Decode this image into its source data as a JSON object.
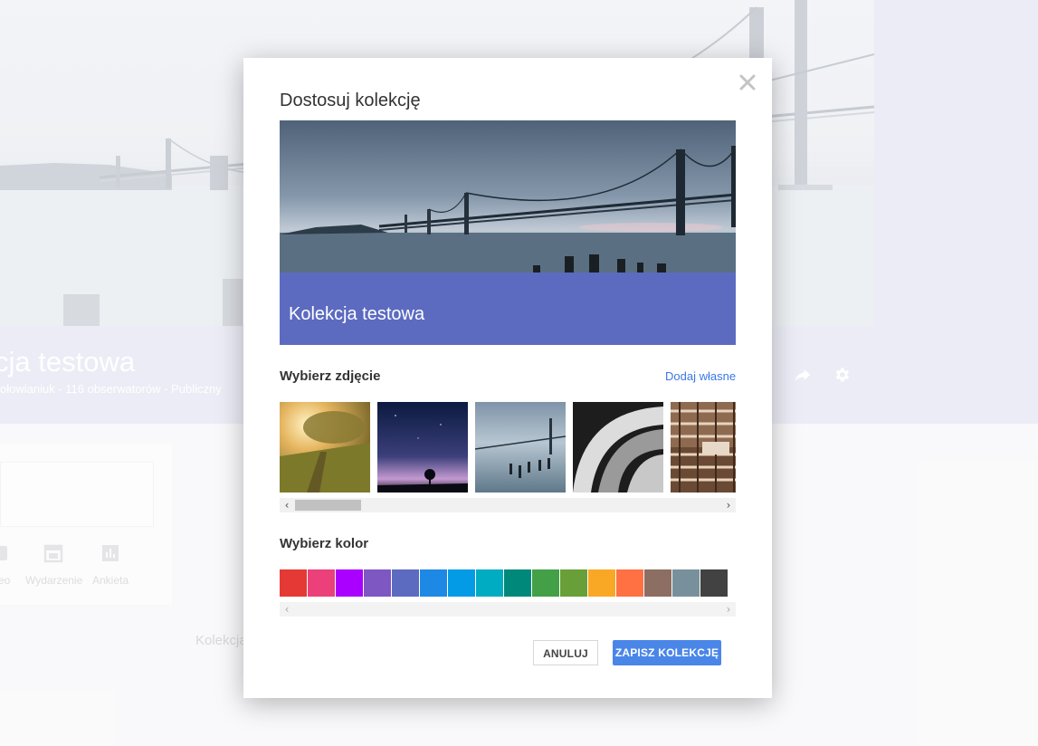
{
  "background": {
    "title": "cja testowa",
    "subtitle": "ołowianiuk - 116 obserwatorów - Publiczny",
    "post_options": [
      "eo",
      "Wydarzenie",
      "Ankieta"
    ],
    "footer_text": "Kolekcja"
  },
  "dialog": {
    "title": "Dostosuj kolekcję",
    "close_icon": "close-icon",
    "preview": {
      "collection_name": "Kolekcja testowa",
      "band_color": "#5c6bc0"
    },
    "photo_section": {
      "label": "Wybierz zdjęcie",
      "add_link": "Dodaj własne",
      "photos": [
        "sunlit-grass",
        "night-sky",
        "bay-bridge",
        "metal-curves",
        "wooden-structure"
      ],
      "scroll_left": "‹",
      "scroll_right": "›"
    },
    "color_section": {
      "label": "Wybierz kolor",
      "colors": [
        "#e53935",
        "#ec407a",
        "#aa00ff",
        "#7e57c2",
        "#5c6bc0",
        "#1e88e5",
        "#039be5",
        "#00acc1",
        "#00897b",
        "#43a047",
        "#689f38",
        "#f9a825",
        "#ff7043",
        "#8d6e63",
        "#78909c",
        "#424242"
      ],
      "scroll_left": "‹",
      "scroll_right": "›"
    },
    "buttons": {
      "cancel": "ANULUJ",
      "save": "ZAPISZ KOLEKCJĘ"
    }
  }
}
